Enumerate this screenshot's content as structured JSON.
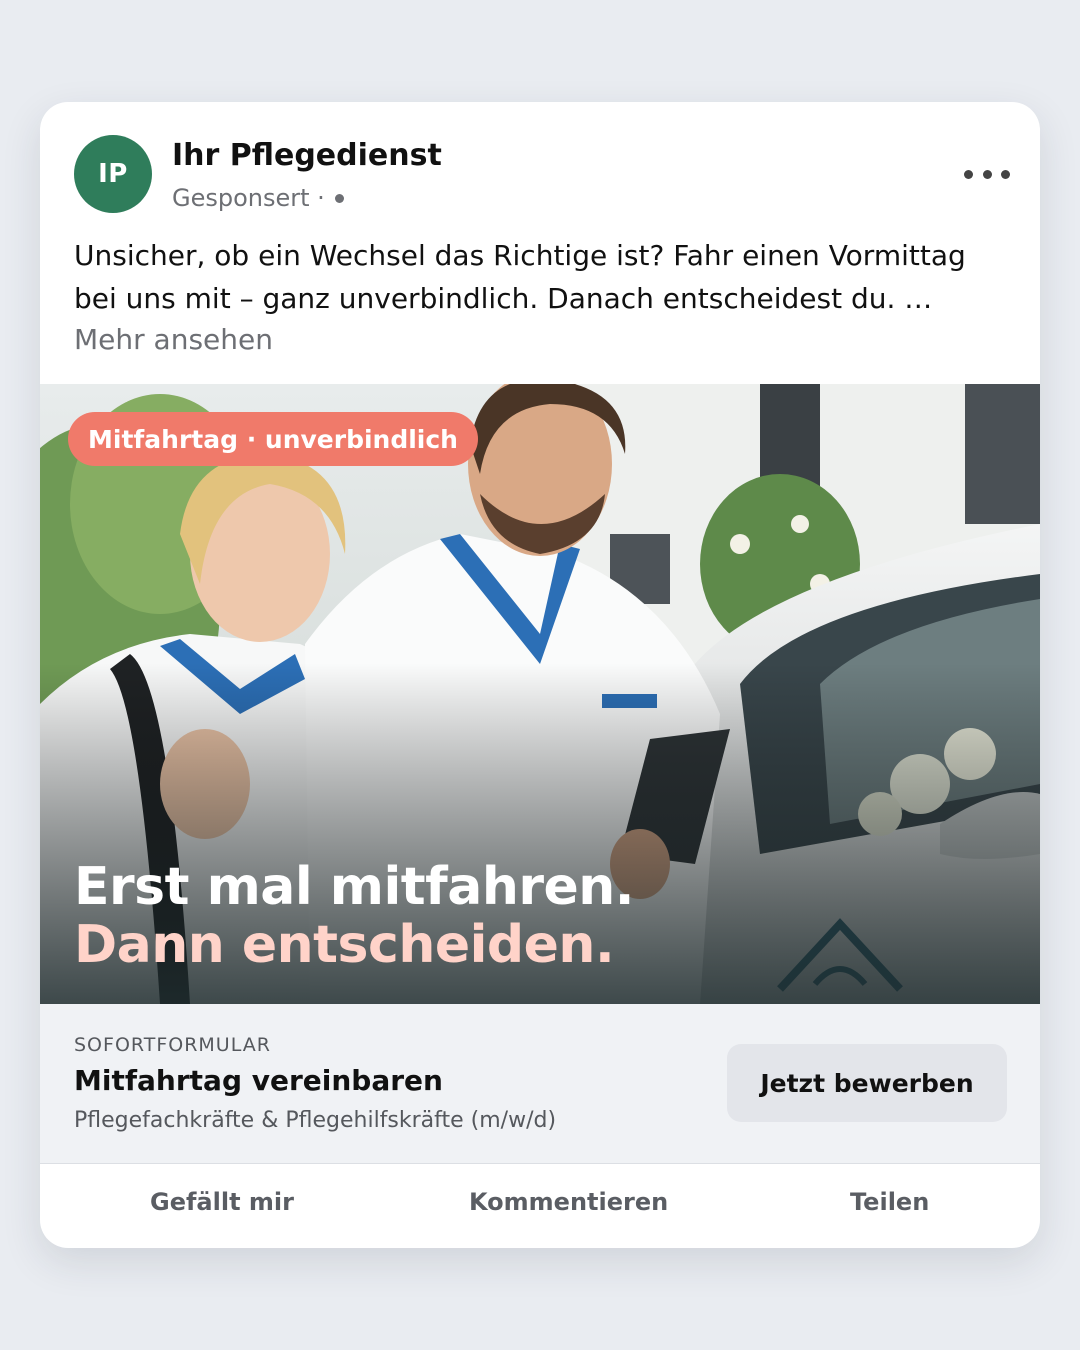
{
  "post": {
    "page_name": "Ihr Pflegedienst",
    "avatar_initials": "IP",
    "avatar_color": "#2f7d5b",
    "sponsored_label": "Gesponsert ·",
    "menu_icon": "more-horizontal-icon",
    "text": "Unsicher, ob ein Wechsel das Richtige ist? Fahr einen Vormittag bei uns mit – ganz unverbindlich. Danach entscheidest du. …",
    "see_more": "Mehr ansehen"
  },
  "image": {
    "badge": "Mitfahrtag · unverbindlich",
    "badge_color": "#f07a6a",
    "headline_line1": "Erst mal mitfahren.",
    "headline_line2": "Dann entscheiden.",
    "accent_color": "#ffd3c9"
  },
  "cta": {
    "form_type": "SOFORTFORMULAR",
    "title": "Mitfahrtag vereinbaren",
    "subtitle": "Pflegefachkräfte & Pflegehilfskräfte (m/w/d)",
    "button_label": "Jetzt bewerben"
  },
  "actions": {
    "like": "Gefällt mir",
    "comment": "Kommentieren",
    "share": "Teilen"
  }
}
